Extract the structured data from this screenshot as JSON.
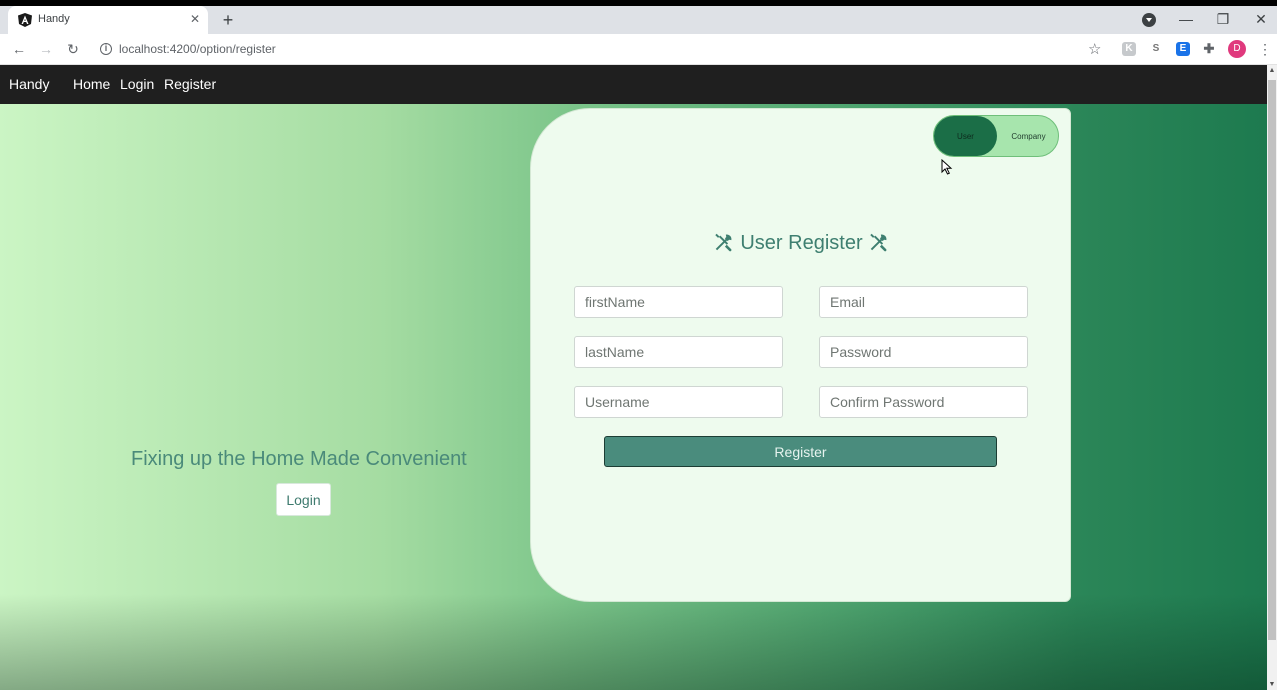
{
  "browser": {
    "tab_title": "Handy",
    "url": "localhost:4200/option/register",
    "profile_initial": "D"
  },
  "navbar": {
    "brand": "Handy",
    "links": [
      "Home",
      "Login",
      "Register"
    ]
  },
  "hero": {
    "tagline": "Fixing up the Home Made Convenient",
    "login_label": "Login"
  },
  "card": {
    "toggle": {
      "user": "User",
      "company": "Company",
      "selected": "User"
    },
    "title": "User Register",
    "fields": {
      "first_name": "firstName",
      "last_name": "lastName",
      "username": "Username",
      "email": "Email",
      "password": "Password",
      "confirm_password": "Confirm Password"
    },
    "submit_label": "Register"
  },
  "colors": {
    "navbar": "#1f1f1f",
    "card": "#eefbee",
    "accent": "#4a8c7d",
    "toggle_active": "#1b6e47"
  }
}
